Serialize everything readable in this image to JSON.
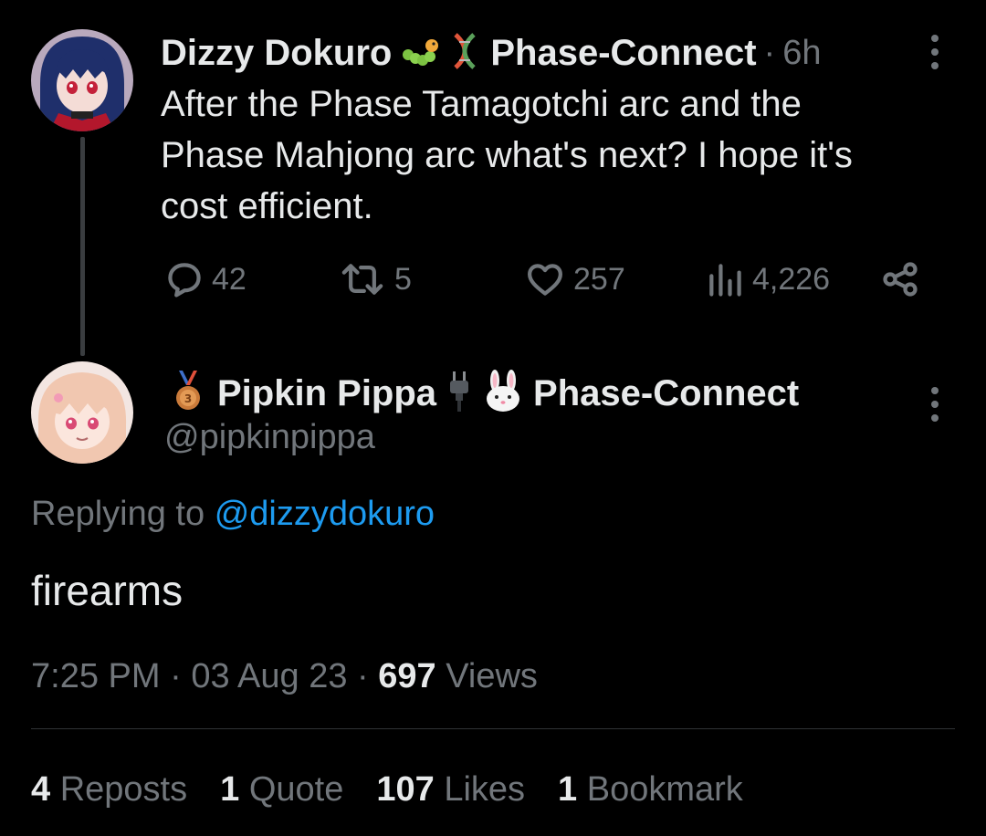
{
  "parent_tweet": {
    "author_name": "Dizzy Dokuro",
    "group_name": "Phase-Connect",
    "separator": "·",
    "time": "6h",
    "text": "After the Phase Tamagotchi arc and the Phase Mahjong arc what's next? I hope it's cost efficient.",
    "actions": {
      "replies": "42",
      "reposts": "5",
      "likes": "257",
      "views": "4,226"
    }
  },
  "reply_tweet": {
    "author_name": "Pipkin Pippa",
    "group_name": "Phase-Connect",
    "handle": "@pipkinpippa",
    "replying_prefix": "Replying to",
    "replying_to": "@dizzydokuro",
    "text": "firearms",
    "time": "7:25 PM",
    "date": "03 Aug 23",
    "views_count": "697",
    "views_label": "Views"
  },
  "engagement": {
    "reposts_count": "4",
    "reposts_label": "Reposts",
    "quotes_count": "1",
    "quotes_label": "Quote",
    "likes_count": "107",
    "likes_label": "Likes",
    "bookmarks_count": "1",
    "bookmarks_label": "Bookmark"
  },
  "colors": {
    "background": "#000000",
    "text_primary": "#e7e9ea",
    "text_muted": "#71767b",
    "link": "#1d9bf0",
    "divider": "#2f3336"
  },
  "icons": [
    "caterpillar-emoji",
    "dna-emoji",
    "more-icon",
    "reply-icon",
    "repost-icon",
    "like-icon",
    "views-icon",
    "share-icon",
    "medal-emoji",
    "plug-emoji",
    "rabbit-emoji"
  ]
}
